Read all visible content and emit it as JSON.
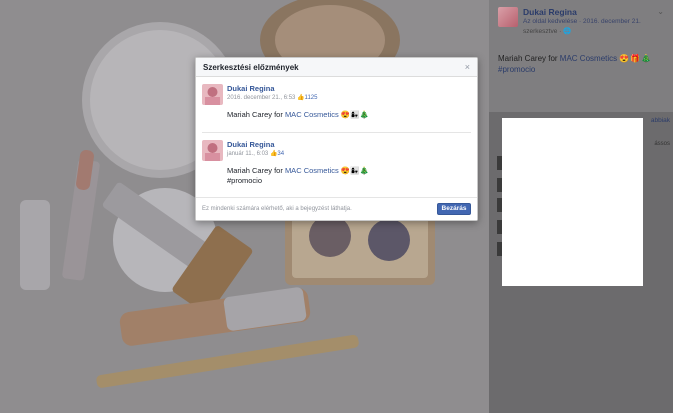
{
  "modal": {
    "title": "Szerkesztési előzmények",
    "close_icon": "close-icon",
    "entries": [
      {
        "author": "Dukai Regina",
        "date": "2016. december 21., 6:53",
        "likes": "1125",
        "line1_prefix": "Mariah Carey for ",
        "line1_link": "MAC Cosmetics",
        "line1_emojis": "😍👩‍👧🎄",
        "line2": ""
      },
      {
        "author": "Dukai Regina",
        "date": "január 11., 6:03",
        "likes": "34",
        "line1_prefix": "Mariah Carey for ",
        "line1_link": "MAC Cosmetics",
        "line1_emojis": "😍👩‍👧🎄",
        "line2": "#promocio"
      }
    ],
    "footer_note": "Ez mindenki számára elérhető, aki a bejegyzést láthatja.",
    "close_button": "Bezárás"
  },
  "panel": {
    "author": "Dukai Regina",
    "sub_line": "Az oldal kedvelése · 2016. december 21.",
    "sub_line2": "szerkesztve · ",
    "post_prefix": "Mariah Carey for ",
    "post_link": "MAC Cosmetics",
    "post_emojis": "😍🎁🎄",
    "post_hashtag": "#promocio",
    "more_link": "abbiak",
    "right_note": "ássos"
  },
  "colors": {
    "brand_blue": "#4267b2",
    "link_blue": "#365899",
    "backdrop": "#7d7b7c"
  }
}
